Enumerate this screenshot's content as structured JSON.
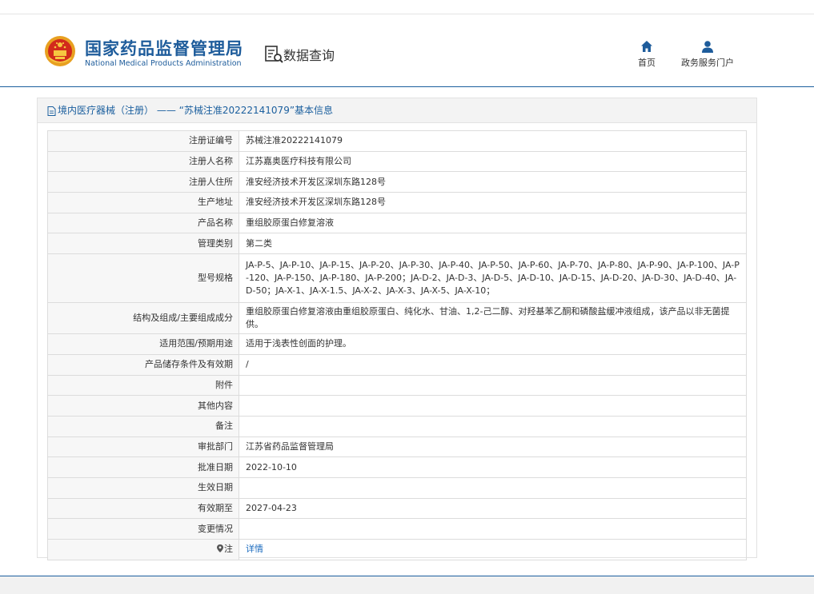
{
  "header": {
    "logo_cn": "国家药品监督管理局",
    "logo_en": "National Medical Products Administration",
    "section_title": "数据查询",
    "nav": {
      "home": "首页",
      "portal": "政务服务门户"
    }
  },
  "panel": {
    "title": "境内医疗器械（注册） —— “苏械注准20222141079”基本信息"
  },
  "rows": [
    {
      "label": "注册证编号",
      "value": "苏械注准20222141079"
    },
    {
      "label": "注册人名称",
      "value": "江苏嘉奥医疗科技有限公司"
    },
    {
      "label": "注册人住所",
      "value": "淮安经济技术开发区深圳东路128号"
    },
    {
      "label": "生产地址",
      "value": "淮安经济技术开发区深圳东路128号"
    },
    {
      "label": "产品名称",
      "value": "重组胶原蛋白修复溶液"
    },
    {
      "label": "管理类别",
      "value": "第二类"
    },
    {
      "label": "型号规格",
      "value": "JA-P-5、JA-P-10、JA-P-15、JA-P-20、JA-P-30、JA-P-40、JA-P-50、JA-P-60、JA-P-70、JA-P-80、JA-P-90、JA-P-100、JA-P-120、JA-P-150、JA-P-180、JA-P-200；JA-D-2、JA-D-3、JA-D-5、JA-D-10、JA-D-15、JA-D-20、JA-D-30、JA-D-40、JA-D-50；JA-X-1、JA-X-1.5、JA-X-2、JA-X-3、JA-X-5、JA-X-10；"
    },
    {
      "label": "结构及组成/主要组成成分",
      "value": "重组胶原蛋白修复溶液由重组胶原蛋白、纯化水、甘油、1,2-己二醇、对羟基苯乙酮和磷酸盐缓冲液组成，该产品以非无菌提供。"
    },
    {
      "label": "适用范围/预期用途",
      "value": "适用于浅表性创面的护理。"
    },
    {
      "label": "产品储存条件及有效期",
      "value": "/"
    },
    {
      "label": "附件",
      "value": ""
    },
    {
      "label": "其他内容",
      "value": ""
    },
    {
      "label": "备注",
      "value": ""
    },
    {
      "label": "审批部门",
      "value": "江苏省药品监督管理局"
    },
    {
      "label": "批准日期",
      "value": "2022-10-10"
    },
    {
      "label": "生效日期",
      "value": ""
    },
    {
      "label": "有效期至",
      "value": "2027-04-23"
    },
    {
      "label": "变更情况",
      "value": ""
    },
    {
      "label": "注",
      "value": "详情"
    }
  ],
  "colors": {
    "brand": "#1e5c9b",
    "link": "#1b6bbf",
    "rule": "#1b5f9e"
  },
  "icons": [
    "emblem-icon",
    "data-query-icon",
    "home-icon",
    "user-icon",
    "document-icon",
    "map-pin-icon"
  ]
}
